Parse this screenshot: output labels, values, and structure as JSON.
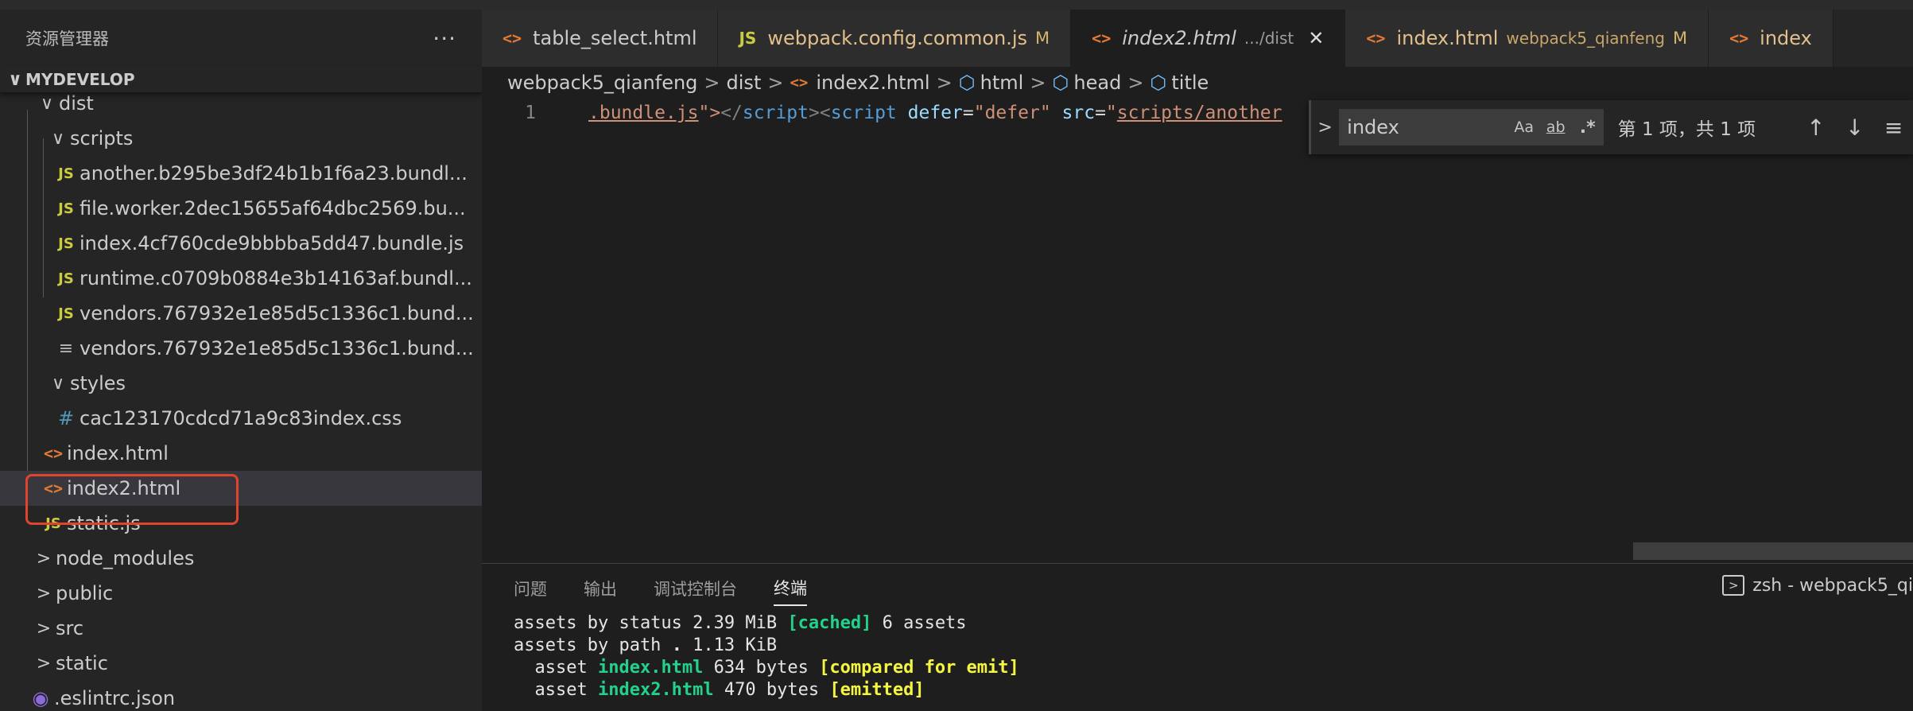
{
  "sidebar": {
    "title": "资源管理器",
    "more": "···",
    "section": "MYDEVELOP",
    "tree": [
      {
        "label": "dist",
        "chevron": "∨"
      },
      {
        "label": "scripts",
        "chevron": "∨"
      },
      {
        "label": "another.b295be3df24b1b1f6a23.bundl...",
        "icon": "JS"
      },
      {
        "label": "file.worker.2dec15655af64dbc2569.bu...",
        "icon": "JS"
      },
      {
        "label": "index.4cf760cde9bbbba5dd47.bundle.js",
        "icon": "JS"
      },
      {
        "label": "runtime.c0709b0884e3b14163af.bundl...",
        "icon": "JS"
      },
      {
        "label": "vendors.767932e1e85d5c1336c1.bund...",
        "icon": "JS"
      },
      {
        "label": "vendors.767932e1e85d5c1336c1.bund...",
        "icon": "≡"
      },
      {
        "label": "styles",
        "chevron": "∨"
      },
      {
        "label": "cac123170cdcd71a9c83index.css",
        "icon": "#"
      },
      {
        "label": "index.html",
        "icon": "<>"
      },
      {
        "label": "index2.html",
        "icon": "<>"
      },
      {
        "label": "static.js",
        "icon": "JS"
      },
      {
        "label": "node_modules",
        "chevron": ">"
      },
      {
        "label": "public",
        "chevron": ">"
      },
      {
        "label": "src",
        "chevron": ">"
      },
      {
        "label": "static",
        "chevron": ">"
      },
      {
        "label": ".eslintrc.json",
        "icon": "◉"
      }
    ]
  },
  "tabs": [
    {
      "label": "table_select.html",
      "icon": "<>"
    },
    {
      "label": "webpack.config.common.js",
      "icon": "JS",
      "badge": "M"
    },
    {
      "label": "index2.html",
      "icon": "<>",
      "desc": ".../dist",
      "close": "✕"
    },
    {
      "label": "index.html",
      "icon": "<>",
      "desc": "webpack5_qianfeng",
      "badge": "M"
    },
    {
      "label": "index",
      "icon": "<>"
    }
  ],
  "breadcrumb": {
    "items": [
      "webpack5_qianfeng",
      "dist",
      "index2.html",
      "html",
      "head",
      "title"
    ],
    "sep": ">"
  },
  "editor": {
    "line_number": "1",
    "tokens": {
      "t1": ".bundle.js",
      "t2": "\">",
      "t3": "</",
      "t4": "script",
      "t5": "><",
      "t6": "script",
      "t7": " defer",
      "t8": "=",
      "t9": "\"defer\"",
      "t10": " src",
      "t11": "=",
      "t12": "\"",
      "t13": "scripts/another"
    }
  },
  "find": {
    "toggle": ">",
    "value": "index",
    "match_case": "Aa",
    "whole_word": "ab",
    "regex": ".*",
    "count": "第 1 项，共 1 项",
    "prev": "↑",
    "next": "↓",
    "selection": "≡"
  },
  "panel": {
    "tabs": [
      "问题",
      "输出",
      "调试控制台",
      "终端"
    ],
    "terminal_label": "zsh - webpack5_qi",
    "terminal_icon": ">",
    "lines": {
      "l1a": "assets by status 2.39 MiB ",
      "l1b": "[cached]",
      "l1c": " 6 assets",
      "l2a": "assets by path ",
      "l2b": ".",
      "l2c": " 1.13 KiB",
      "l3a": "  asset ",
      "l3b": "index.html",
      "l3c": " 634 bytes ",
      "l3d": "[compared for emit]",
      "l4a": "  asset ",
      "l4b": "index2.html",
      "l4c": " 470 bytes ",
      "l4d": "[emitted]"
    }
  },
  "colors": {
    "highlight_box": "#e0442f",
    "html_icon": "#e37933",
    "js_icon": "#cbcb41",
    "modified": "#e2c08d"
  }
}
